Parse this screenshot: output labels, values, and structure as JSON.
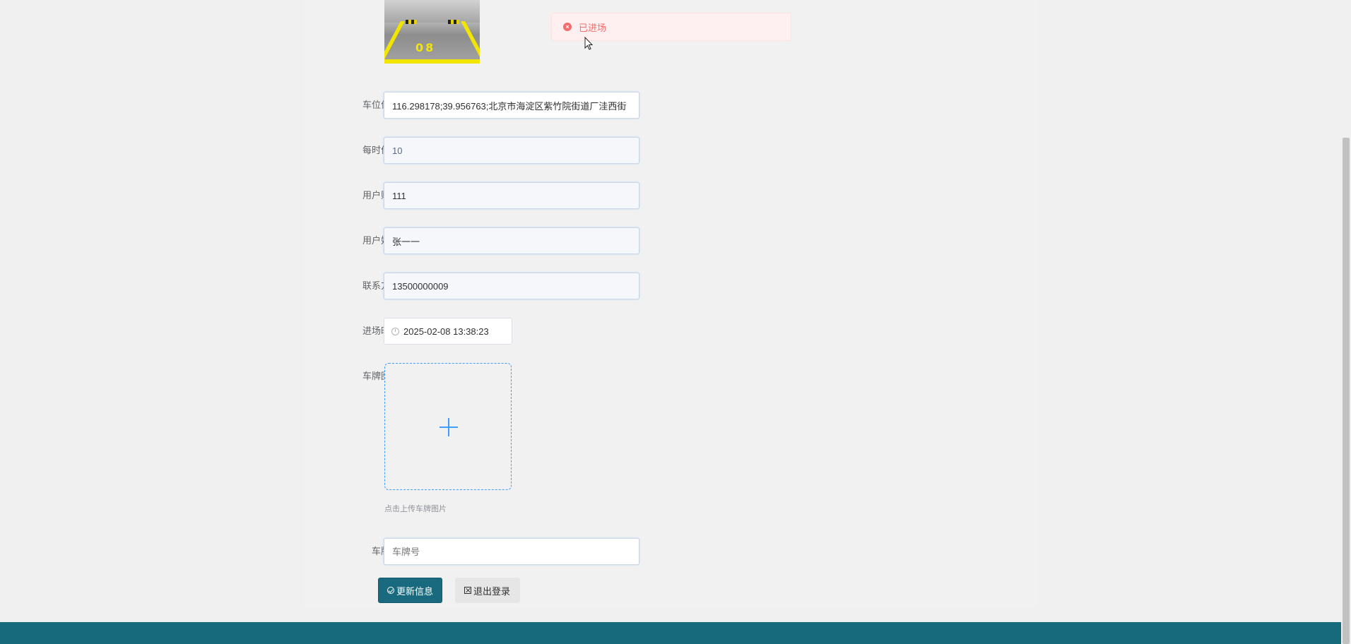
{
  "toast": {
    "type": "error",
    "message": "已进场",
    "icon": "close-circle-icon",
    "color": "#f56c6c"
  },
  "parking_image": {
    "spot_number": "08"
  },
  "form": {
    "location": {
      "label": "车位位置",
      "value": "116.298178;39.956763;北京市海淀区紫竹院街道厂洼西街"
    },
    "price": {
      "label": "每时价格",
      "value": "10"
    },
    "account": {
      "label": "用户账号",
      "value": "111"
    },
    "name": {
      "label": "用户姓名",
      "value": "张一一"
    },
    "phone": {
      "label": "联系方式",
      "value": "13500000009"
    },
    "entry_time": {
      "label": "进场时间",
      "value": "2025-02-08 13:38:23",
      "icon": "clock-icon"
    },
    "plate_image": {
      "label": "车牌图片",
      "tip": "点击上传车牌图片",
      "icon": "plus-icon"
    },
    "plate_number": {
      "label": "车牌号",
      "placeholder": "车牌号"
    }
  },
  "buttons": {
    "update": {
      "label": "更新信息",
      "icon": "check-circle-icon"
    },
    "logout": {
      "label": "退出登录",
      "icon": "close-square-icon"
    }
  },
  "colors": {
    "primary": "#1a6a7f",
    "footer": "#17697c",
    "upload_border": "#409eff"
  }
}
